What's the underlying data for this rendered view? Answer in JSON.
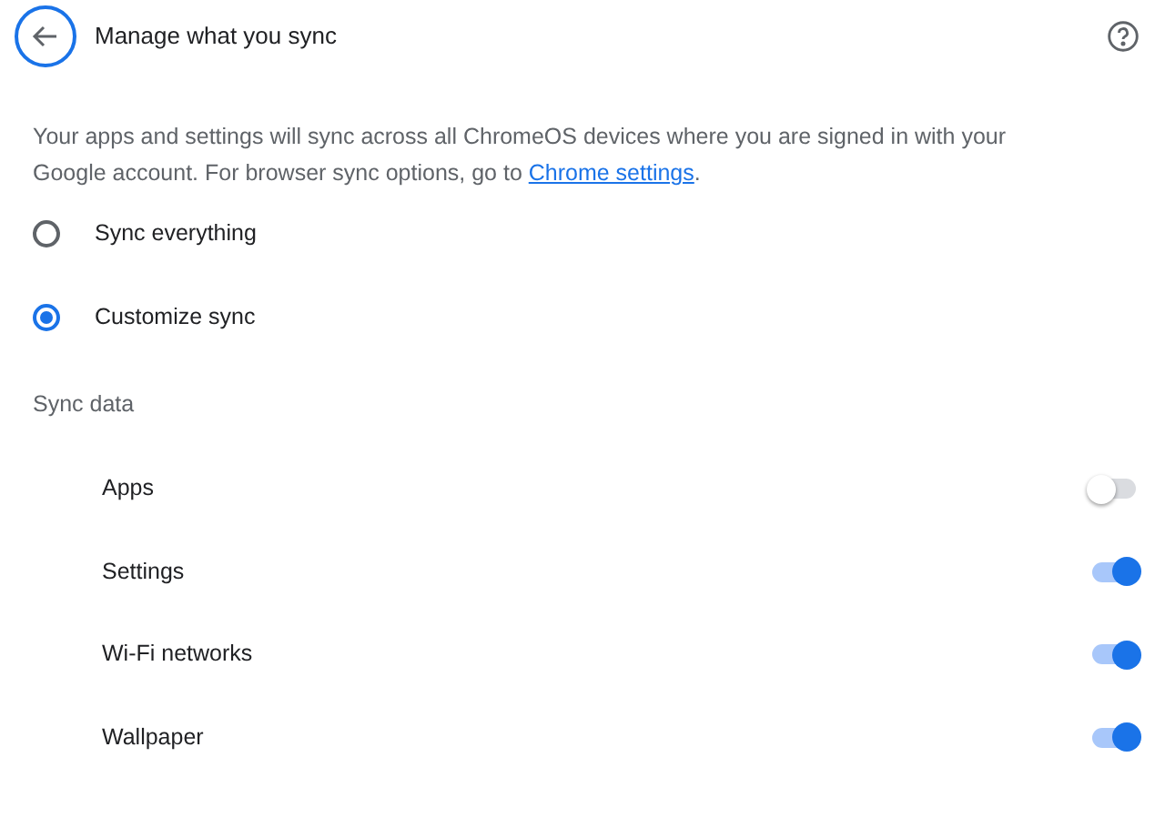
{
  "header": {
    "title": "Manage what you sync"
  },
  "description": {
    "text": "Your apps and settings will sync across all ChromeOS devices where you are signed in with your Google account. For browser sync options, go to ",
    "link": "Chrome settings",
    "after": "."
  },
  "sync_options": [
    {
      "label": "Sync everything",
      "selected": false
    },
    {
      "label": "Customize sync",
      "selected": true
    }
  ],
  "sync_data": {
    "heading": "Sync data",
    "items": [
      {
        "label": "Apps",
        "on": false
      },
      {
        "label": "Settings",
        "on": true
      },
      {
        "label": "Wi-Fi networks",
        "on": true
      },
      {
        "label": "Wallpaper",
        "on": true
      }
    ]
  }
}
